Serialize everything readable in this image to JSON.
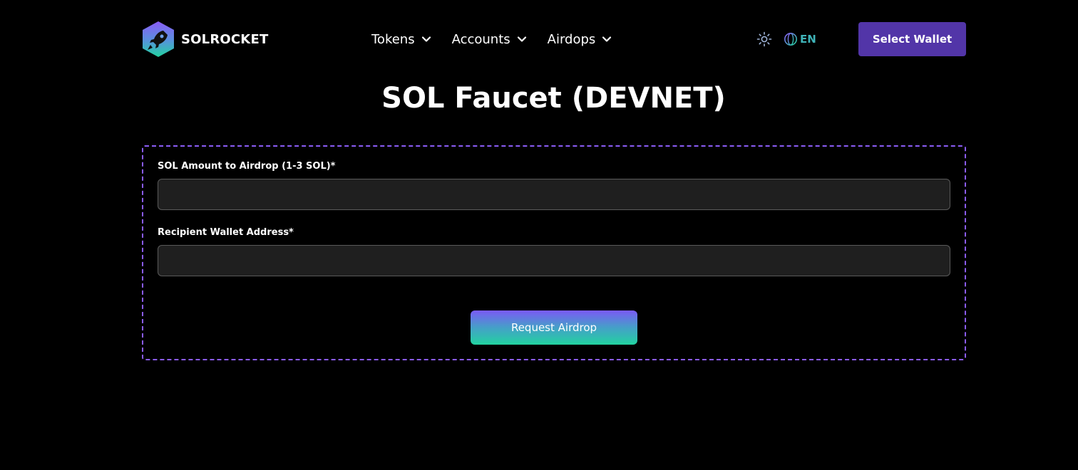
{
  "brand": {
    "name": "SOLROCKET",
    "logo_icon": "rocket-hexagon-icon"
  },
  "nav": {
    "items": [
      {
        "label": "Tokens",
        "icon": "chevron-down-icon"
      },
      {
        "label": "Accounts",
        "icon": "chevron-down-icon"
      },
      {
        "label": "Airdops",
        "icon": "chevron-down-icon"
      }
    ]
  },
  "header": {
    "theme_icon": "sun-icon",
    "language": {
      "icon": "globe-icon",
      "label": "EN"
    },
    "wallet_button": "Select Wallet"
  },
  "page": {
    "title": "SOL Faucet (DEVNET)"
  },
  "form": {
    "amount": {
      "label": "SOL Amount to Airdrop (1-3 SOL)*",
      "value": "",
      "placeholder": ""
    },
    "recipient": {
      "label": "Recipient Wallet Address*",
      "value": "",
      "placeholder": ""
    },
    "submit_label": "Request Airdrop"
  },
  "colors": {
    "background": "#000000",
    "accent_purple": "#5235a8",
    "dashed_border": "#8b5cf6",
    "input_bg": "#1f1f1f",
    "gradient_top": "#7a5af5",
    "gradient_bottom": "#22d3a0",
    "language_text": "#3fb3b8"
  }
}
